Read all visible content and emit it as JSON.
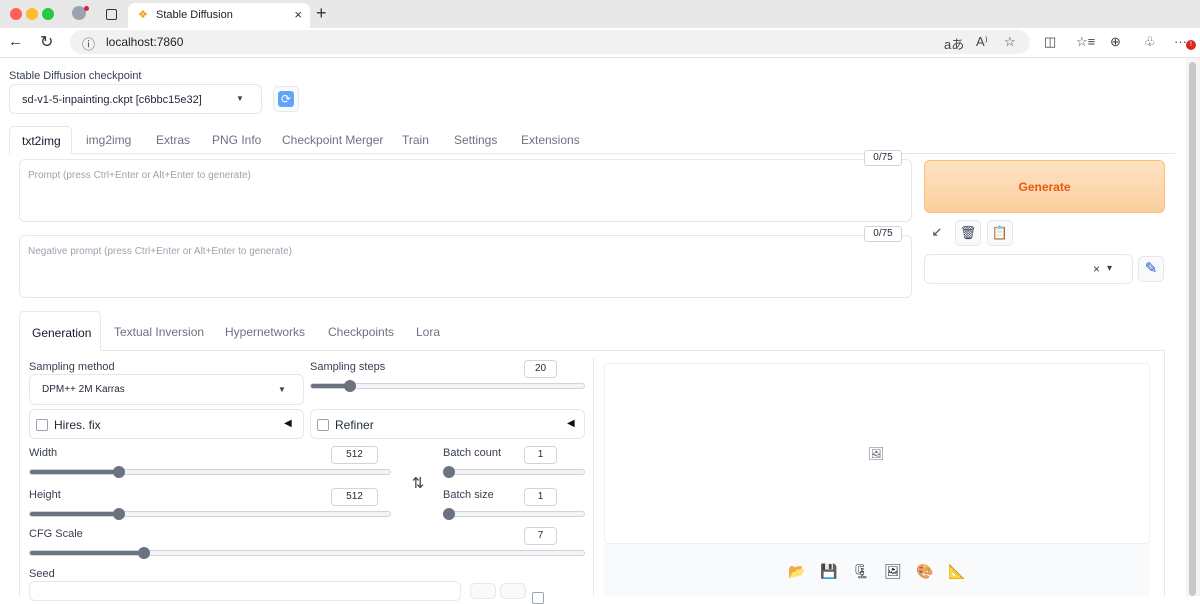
{
  "browser": {
    "tab_title": "Stable Diffusion",
    "tab_close": "×",
    "new_tab": "+",
    "url": "localhost:7860",
    "back": "←",
    "reload": "↻",
    "info": "ⓘ",
    "toolbar_icons": [
      "aあ",
      "A⁾",
      "☆",
      "◫",
      "☆≡",
      "⊕",
      "♧",
      "···"
    ],
    "notification_badge": "!"
  },
  "checkpoint": {
    "label": "Stable Diffusion checkpoint",
    "value": "sd-v1-5-inpainting.ckpt [c6bbc15e32]",
    "refresh_icon": "⟳"
  },
  "main_tabs": [
    "txt2img",
    "img2img",
    "Extras",
    "PNG Info",
    "Checkpoint Merger",
    "Train",
    "Settings",
    "Extensions"
  ],
  "prompt": {
    "placeholder": "Prompt (press Ctrl+Enter or Alt+Enter to generate)",
    "counter": "0/75"
  },
  "negative_prompt": {
    "placeholder": "Negative prompt (press Ctrl+Enter or Alt+Enter to generate)",
    "counter": "0/75"
  },
  "generate": {
    "label": "Generate",
    "tool_icons": [
      "↙",
      "🗑",
      "📋"
    ],
    "styles_clear": "×",
    "styles_caret": "▾",
    "edit_icon": "✎"
  },
  "sub_tabs": [
    "Generation",
    "Textual Inversion",
    "Hypernetworks",
    "Checkpoints",
    "Lora"
  ],
  "sampling_method": {
    "label": "Sampling method",
    "value": "DPM++ 2M Karras"
  },
  "sampling_steps": {
    "label": "Sampling steps",
    "value": "20",
    "fraction": 0.13
  },
  "hires_fix": {
    "label": "Hires. fix"
  },
  "refiner": {
    "label": "Refiner"
  },
  "width": {
    "label": "Width",
    "value": "512",
    "fraction": 0.24
  },
  "height": {
    "label": "Height",
    "value": "512",
    "fraction": 0.24
  },
  "swap_icon": "⇅",
  "batch_count": {
    "label": "Batch count",
    "value": "1",
    "fraction": 0.0
  },
  "batch_size": {
    "label": "Batch size",
    "value": "1",
    "fraction": 0.0
  },
  "cfg_scale": {
    "label": "CFG Scale",
    "value": "7",
    "fraction": 0.2
  },
  "seed": {
    "label": "Seed"
  },
  "gallery": {
    "placeholder_icon": "🖼",
    "buttons": [
      "📂",
      "💾",
      "🗜",
      "🖼",
      "🎨",
      "📐"
    ]
  },
  "colors": {
    "generate_bg": "#fbd7b0",
    "generate_text": "#ea580c",
    "slider": "#6b7280"
  }
}
